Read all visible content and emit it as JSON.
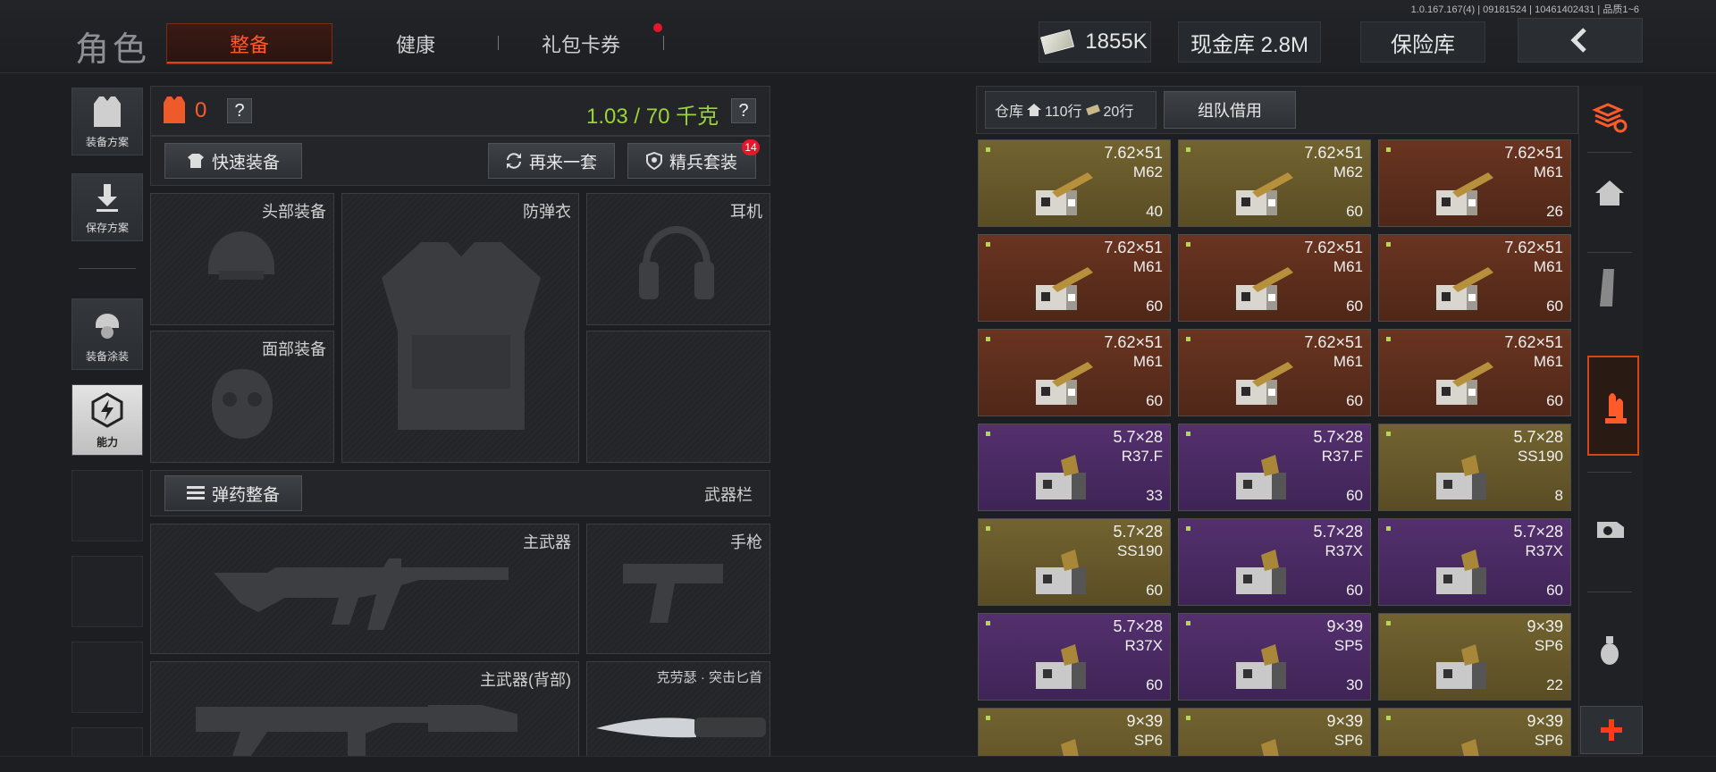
{
  "version": "1.0.167.167(4) | 09181524 | 10461402431 | 品质1~6",
  "header": {
    "title": "角色",
    "tabs": [
      {
        "label": "整备",
        "active": true
      },
      {
        "label": "健康"
      },
      {
        "label": "礼包卡券",
        "badge_dot": true
      }
    ],
    "cash": "1855K",
    "cash_vault": "现金库 2.8M",
    "safe_vault": "保险库"
  },
  "left_nav": [
    {
      "label": "装备方案",
      "icon": "vest-icon"
    },
    {
      "label": "保存方案",
      "icon": "download-icon"
    },
    {
      "label": "装备涂装",
      "icon": "helmet-skin-icon"
    },
    {
      "label": "能力",
      "icon": "ability-icon",
      "active": true
    }
  ],
  "loadout": {
    "armor_count": "0",
    "help": "?",
    "weight": "1.03 / 70 千克",
    "quick_equip": "快速装备",
    "again": "再来一套",
    "elite_set": "精兵套装",
    "elite_badge": "14",
    "slots": {
      "head": "头部装备",
      "body_armor": "防弹衣",
      "headset": "耳机",
      "face": "面部装备"
    },
    "ammo_setup": "弹药整备",
    "weapon_bar": "武器栏",
    "weapons": {
      "primary": "主武器",
      "pistol": "手枪",
      "primary_back": "主武器(背部)",
      "melee": "克劳瑟 · 突击匕首"
    }
  },
  "storage": {
    "warehouse_label": "仓库",
    "rows": "110行",
    "rows2": "20行",
    "team_borrow": "组队借用",
    "items": [
      {
        "c1": "7.62×51",
        "c2": "M62",
        "count": "40",
        "tone": "gold"
      },
      {
        "c1": "7.62×51",
        "c2": "M62",
        "count": "60",
        "tone": "gold"
      },
      {
        "c1": "7.62×51",
        "c2": "M61",
        "count": "26",
        "tone": "red"
      },
      {
        "c1": "7.62×51",
        "c2": "M61",
        "count": "60",
        "tone": "red"
      },
      {
        "c1": "7.62×51",
        "c2": "M61",
        "count": "60",
        "tone": "red"
      },
      {
        "c1": "7.62×51",
        "c2": "M61",
        "count": "60",
        "tone": "red"
      },
      {
        "c1": "7.62×51",
        "c2": "M61",
        "count": "60",
        "tone": "red"
      },
      {
        "c1": "7.62×51",
        "c2": "M61",
        "count": "60",
        "tone": "red"
      },
      {
        "c1": "7.62×51",
        "c2": "M61",
        "count": "60",
        "tone": "red"
      },
      {
        "c1": "5.7×28",
        "c2": "R37.F",
        "count": "33",
        "tone": "purple"
      },
      {
        "c1": "5.7×28",
        "c2": "R37.F",
        "count": "60",
        "tone": "purple"
      },
      {
        "c1": "5.7×28",
        "c2": "SS190",
        "count": "8",
        "tone": "gold"
      },
      {
        "c1": "5.7×28",
        "c2": "SS190",
        "count": "60",
        "tone": "gold"
      },
      {
        "c1": "5.7×28",
        "c2": "R37X",
        "count": "60",
        "tone": "purple"
      },
      {
        "c1": "5.7×28",
        "c2": "R37X",
        "count": "60",
        "tone": "purple"
      },
      {
        "c1": "5.7×28",
        "c2": "R37X",
        "count": "60",
        "tone": "purple"
      },
      {
        "c1": "9×39",
        "c2": "SP5",
        "count": "30",
        "tone": "purple"
      },
      {
        "c1": "9×39",
        "c2": "SP6",
        "count": "22",
        "tone": "gold"
      },
      {
        "c1": "9×39",
        "c2": "SP6",
        "count": "",
        "tone": "gold"
      },
      {
        "c1": "9×39",
        "c2": "SP6",
        "count": "",
        "tone": "gold"
      },
      {
        "c1": "9×39",
        "c2": "SP6",
        "count": "",
        "tone": "gold"
      }
    ]
  },
  "right_nav": [
    "sort-icon",
    "home-icon",
    "magazine-icon",
    "ammo-icon",
    "sight-icon",
    "grenade-icon",
    "add-icon"
  ],
  "colors": {
    "accent": "#ff5a2a",
    "weight": "#9bd33a",
    "gold": "#6e5f2a",
    "red": "#5e2e1d",
    "purple": "#4d2b66"
  }
}
